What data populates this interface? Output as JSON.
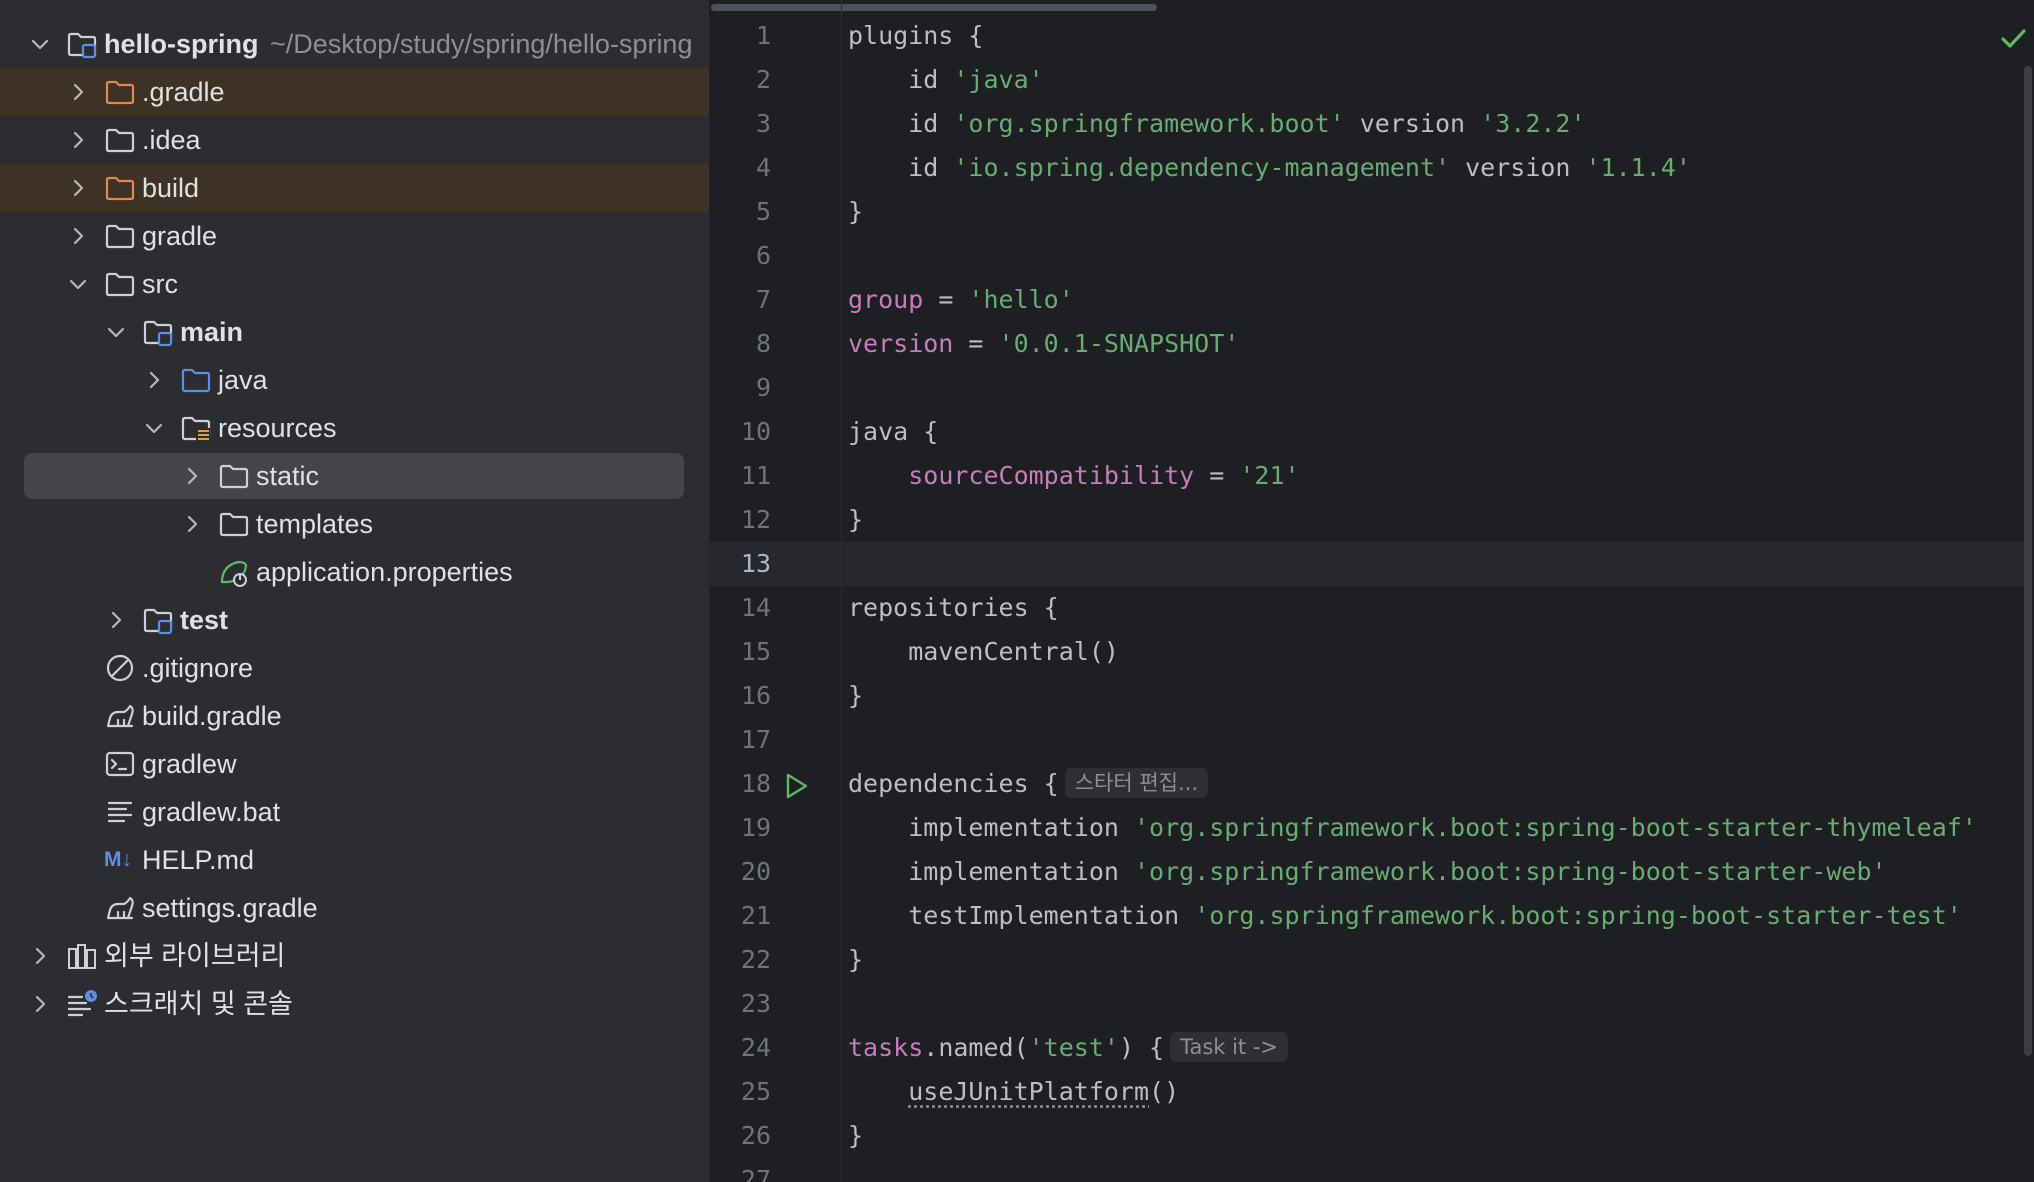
{
  "project_tree": {
    "root": {
      "label": "hello-spring",
      "path": "~/Desktop/study/spring/hello-spring"
    },
    "items": [
      {
        "label": ".gradle",
        "icon": "folder-excluded-icon"
      },
      {
        "label": ".idea",
        "icon": "folder-icon"
      },
      {
        "label": "build",
        "icon": "folder-excluded-icon"
      },
      {
        "label": "gradle",
        "icon": "folder-icon"
      },
      {
        "label": "src",
        "icon": "folder-icon"
      },
      {
        "label": "main",
        "icon": "module-folder-icon"
      },
      {
        "label": "java",
        "icon": "source-folder-icon"
      },
      {
        "label": "resources",
        "icon": "resources-folder-icon"
      },
      {
        "label": "static",
        "icon": "folder-icon"
      },
      {
        "label": "templates",
        "icon": "folder-icon"
      },
      {
        "label": "application.properties",
        "icon": "spring-properties-icon"
      },
      {
        "label": "test",
        "icon": "module-folder-icon"
      },
      {
        "label": ".gitignore",
        "icon": "gitignore-icon"
      },
      {
        "label": "build.gradle",
        "icon": "gradle-icon"
      },
      {
        "label": "gradlew",
        "icon": "terminal-file-icon"
      },
      {
        "label": "gradlew.bat",
        "icon": "text-file-icon"
      },
      {
        "label": "HELP.md",
        "icon": "markdown-icon"
      },
      {
        "label": "settings.gradle",
        "icon": "gradle-icon"
      },
      {
        "label": "외부 라이브러리",
        "icon": "library-icon"
      },
      {
        "label": "스크래치 및 콘솔",
        "icon": "scratch-icon"
      }
    ],
    "markdown_badge": "M↓"
  },
  "editor": {
    "line_numbers": [
      "1",
      "2",
      "3",
      "4",
      "5",
      "6",
      "7",
      "8",
      "9",
      "10",
      "11",
      "12",
      "13",
      "14",
      "15",
      "16",
      "17",
      "18",
      "19",
      "20",
      "21",
      "22",
      "23",
      "24",
      "25",
      "26",
      "27"
    ],
    "current_line": "13",
    "lines": [
      [
        {
          "t": "plain",
          "v": "plugins {"
        }
      ],
      [
        {
          "t": "plain",
          "v": "    id "
        },
        {
          "t": "str",
          "v": "'java'"
        }
      ],
      [
        {
          "t": "plain",
          "v": "    id "
        },
        {
          "t": "str",
          "v": "'org.springframework.boot'"
        },
        {
          "t": "plain",
          "v": " version "
        },
        {
          "t": "str",
          "v": "'3.2.2'"
        }
      ],
      [
        {
          "t": "plain",
          "v": "    id "
        },
        {
          "t": "str",
          "v": "'io.spring.dependency-management'"
        },
        {
          "t": "plain",
          "v": " version "
        },
        {
          "t": "str",
          "v": "'1.1.4'"
        }
      ],
      [
        {
          "t": "plain",
          "v": "}"
        }
      ],
      [],
      [
        {
          "t": "prop",
          "v": "group"
        },
        {
          "t": "plain",
          "v": " = "
        },
        {
          "t": "str",
          "v": "'hello'"
        }
      ],
      [
        {
          "t": "prop",
          "v": "version"
        },
        {
          "t": "plain",
          "v": " = "
        },
        {
          "t": "str",
          "v": "'0.0.1-SNAPSHOT'"
        }
      ],
      [],
      [
        {
          "t": "plain",
          "v": "java {"
        }
      ],
      [
        {
          "t": "plain",
          "v": "    "
        },
        {
          "t": "prop",
          "v": "sourceCompatibility"
        },
        {
          "t": "plain",
          "v": " = "
        },
        {
          "t": "str",
          "v": "'21'"
        }
      ],
      [
        {
          "t": "plain",
          "v": "}"
        }
      ],
      [],
      [
        {
          "t": "plain",
          "v": "repositories {"
        }
      ],
      [
        {
          "t": "plain",
          "v": "    mavenCentral()"
        }
      ],
      [
        {
          "t": "plain",
          "v": "}"
        }
      ],
      [],
      [
        {
          "t": "plain",
          "v": "dependencies {"
        },
        {
          "t": "inlay",
          "v": "스타터 편집..."
        }
      ],
      [
        {
          "t": "plain",
          "v": "    implementation "
        },
        {
          "t": "str",
          "v": "'org.springframework.boot:spring-boot-starter-thymeleaf'"
        }
      ],
      [
        {
          "t": "plain",
          "v": "    implementation "
        },
        {
          "t": "str",
          "v": "'org.springframework.boot:spring-boot-starter-web'"
        }
      ],
      [
        {
          "t": "plain",
          "v": "    testImplementation "
        },
        {
          "t": "str",
          "v": "'org.springframework.boot:spring-boot-starter-test'"
        }
      ],
      [
        {
          "t": "plain",
          "v": "}"
        }
      ],
      [],
      [
        {
          "t": "prop",
          "v": "tasks"
        },
        {
          "t": "plain",
          "v": ".named("
        },
        {
          "t": "str",
          "v": "'test'"
        },
        {
          "t": "plain",
          "v": ") {"
        },
        {
          "t": "inlay",
          "v": "Task it ->"
        }
      ],
      [
        {
          "t": "plain",
          "v": "    "
        },
        {
          "t": "under",
          "v": "useJUnitPlatform"
        },
        {
          "t": "plain",
          "v": "()"
        }
      ],
      [
        {
          "t": "plain",
          "v": "}"
        }
      ],
      []
    ]
  },
  "colors": {
    "tree_background": "#2b2d30",
    "editor_background": "#1e1f22",
    "excluded_row": "#3d3223",
    "selected_row": "#43454a",
    "string": "#6aab73",
    "property": "#c77dbb",
    "text": "#bcbec4"
  }
}
